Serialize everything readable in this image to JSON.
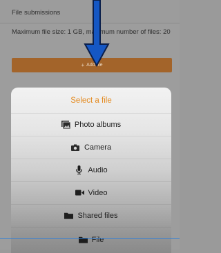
{
  "header": {
    "title": "File submissions"
  },
  "info": {
    "limits_text": "Maximum file size: 1 GB, maximum number of files: 20"
  },
  "add_file_button": {
    "label": "Add file"
  },
  "action_sheet": {
    "title": "Select a file",
    "options": [
      {
        "label": "Photo albums",
        "icon": "photo-albums-icon"
      },
      {
        "label": "Camera",
        "icon": "camera-icon"
      },
      {
        "label": "Audio",
        "icon": "microphone-icon"
      },
      {
        "label": "Video",
        "icon": "video-camera-icon"
      },
      {
        "label": "Shared files",
        "icon": "folder-icon"
      },
      {
        "label": "File",
        "icon": "folder-icon"
      }
    ]
  },
  "colors": {
    "accent": "#e48a1f",
    "button": "#a3642a",
    "arrow": "#1557c4",
    "line": "#2f7fd8"
  }
}
